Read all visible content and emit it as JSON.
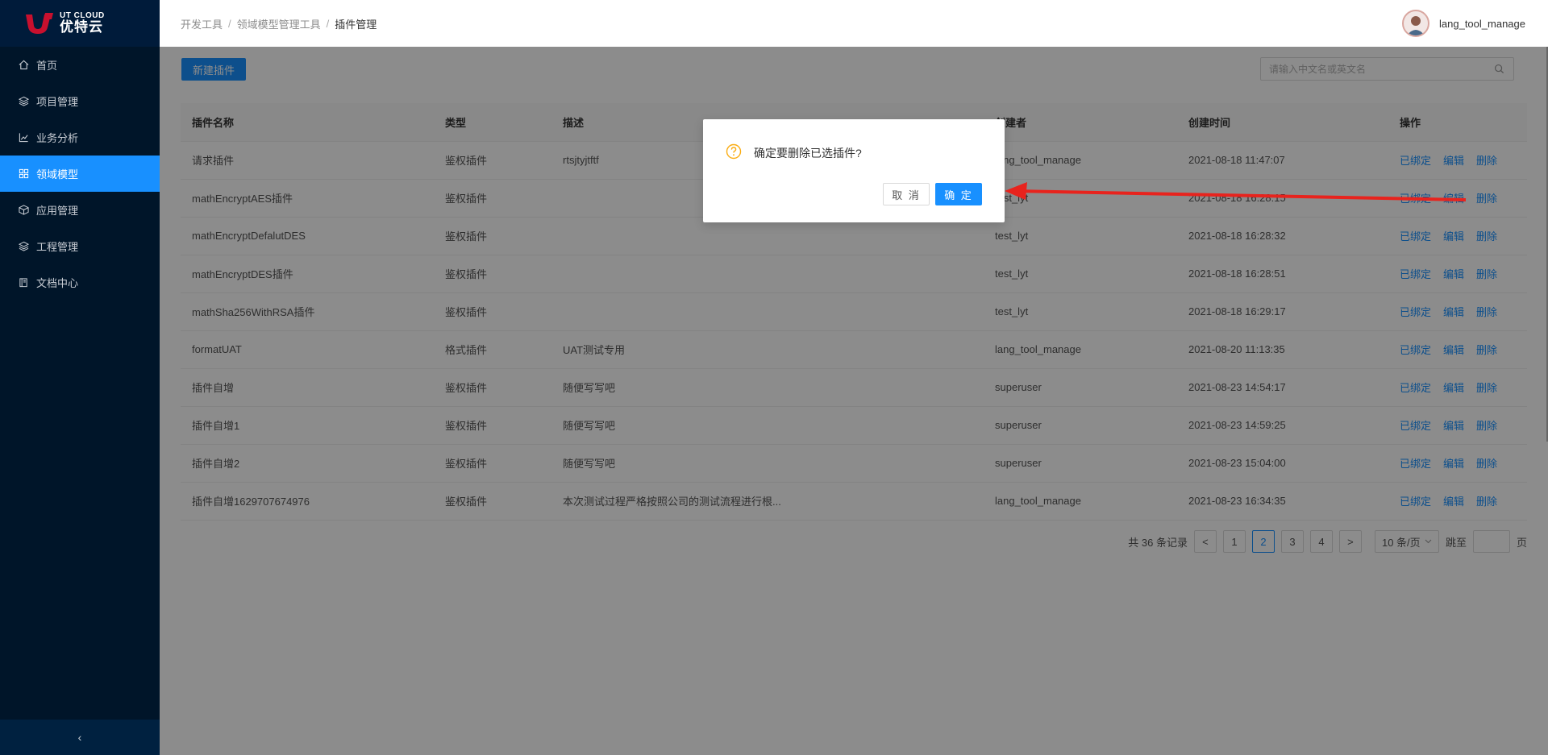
{
  "brand": {
    "en": "UT CLOUD",
    "cn": "优特云",
    "color": "#c8102e"
  },
  "sidebar": {
    "items": [
      {
        "label": "首页",
        "icon": "home-icon"
      },
      {
        "label": "项目管理",
        "icon": "layers-icon"
      },
      {
        "label": "业务分析",
        "icon": "chart-icon"
      },
      {
        "label": "领域模型",
        "icon": "grid-icon",
        "active": true
      },
      {
        "label": "应用管理",
        "icon": "cube-icon"
      },
      {
        "label": "工程管理",
        "icon": "layers-icon"
      },
      {
        "label": "文档中心",
        "icon": "book-icon"
      }
    ],
    "collapse": "‹"
  },
  "header": {
    "breadcrumb": [
      "开发工具",
      "领域模型管理工具",
      "插件管理"
    ],
    "separator": "/",
    "user": "lang_tool_manage"
  },
  "toolbar": {
    "new_label": "新建插件",
    "search_placeholder": "请输入中文名或英文名"
  },
  "table": {
    "columns": [
      "插件名称",
      "类型",
      "描述",
      "创建者",
      "创建时间",
      "操作"
    ],
    "rows": [
      {
        "name": "请求插件",
        "type": "鉴权插件",
        "desc": "rtsjtyjtftf",
        "creator": "lang_tool_manage",
        "time": "2021-08-18 11:47:07"
      },
      {
        "name": "mathEncryptAES插件",
        "type": "鉴权插件",
        "desc": "",
        "creator": "test_lyt",
        "time": "2021-08-18 16:28:15"
      },
      {
        "name": "mathEncryptDefalutDES",
        "type": "鉴权插件",
        "desc": "",
        "creator": "test_lyt",
        "time": "2021-08-18 16:28:32"
      },
      {
        "name": "mathEncryptDES插件",
        "type": "鉴权插件",
        "desc": "",
        "creator": "test_lyt",
        "time": "2021-08-18 16:28:51"
      },
      {
        "name": "mathSha256WithRSA插件",
        "type": "鉴权插件",
        "desc": "",
        "creator": "test_lyt",
        "time": "2021-08-18 16:29:17"
      },
      {
        "name": "formatUAT",
        "type": "格式插件",
        "desc": "UAT测试专用",
        "creator": "lang_tool_manage",
        "time": "2021-08-20 11:13:35"
      },
      {
        "name": "插件自增",
        "type": "鉴权插件",
        "desc": "随便写写吧",
        "creator": "superuser",
        "time": "2021-08-23 14:54:17"
      },
      {
        "name": "插件自增1",
        "type": "鉴权插件",
        "desc": "随便写写吧",
        "creator": "superuser",
        "time": "2021-08-23 14:59:25"
      },
      {
        "name": "插件自增2",
        "type": "鉴权插件",
        "desc": "随便写写吧",
        "creator": "superuser",
        "time": "2021-08-23 15:04:00"
      },
      {
        "name": "插件自增1629707674976",
        "type": "鉴权插件",
        "desc": "本次测试过程严格按照公司的测试流程进行根...",
        "creator": "lang_tool_manage",
        "time": "2021-08-23 16:34:35"
      }
    ],
    "actions": [
      "已绑定",
      "编辑",
      "删除"
    ]
  },
  "pagination": {
    "total": "共 36 条记录",
    "prev": "<",
    "next": ">",
    "pages": [
      "1",
      "2",
      "3",
      "4"
    ],
    "current": "2",
    "page_size": "10 条/页",
    "jump_label": "跳至",
    "page_suffix": "页"
  },
  "modal": {
    "message": "确定要删除已选插件?",
    "cancel": "取 消",
    "ok": "确 定"
  },
  "colors": {
    "primary": "#1890ff",
    "sidebar": "#001529",
    "warning": "#faad14",
    "arrow": "#e8231d"
  }
}
